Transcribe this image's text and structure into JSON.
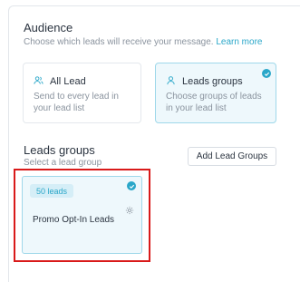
{
  "audience": {
    "title": "Audience",
    "subtitle": "Choose which leads will receive your message.",
    "learn_more": "Learn more",
    "options": [
      {
        "title": "All Lead",
        "description": "Send to every lead in your lead list",
        "selected": false,
        "icon": "users-icon"
      },
      {
        "title": "Leads groups",
        "description": "Choose groups of leads in your lead list",
        "selected": true,
        "icon": "user-icon"
      }
    ]
  },
  "leads_groups": {
    "title": "Leads groups",
    "subtitle": "Select a lead group",
    "add_button": "Add Lead Groups",
    "groups": [
      {
        "badge": "50 leads",
        "name": "Promo Opt-In Leads",
        "selected": true
      }
    ]
  },
  "colors": {
    "accent": "#2aa7c9",
    "selected_bg": "#eef8fc",
    "highlight": "#d91a1a"
  }
}
